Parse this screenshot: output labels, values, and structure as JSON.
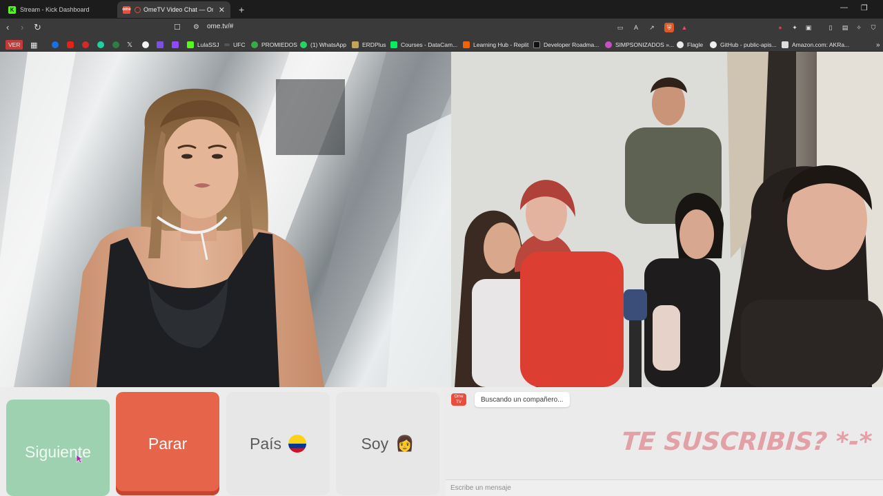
{
  "browser": {
    "tabs": [
      {
        "title": "Stream - Kick Dashboard",
        "active": false,
        "favicon": "kick-icon"
      },
      {
        "title": "OmeTV Video Chat — Omeg",
        "active": true,
        "favicon": "ometv-icon"
      }
    ],
    "new_tab": "+",
    "url": "ome.tv/#",
    "bookmarks": [
      {
        "label": "VER"
      },
      {
        "label": "LulaSSJ"
      },
      {
        "label": "UFC"
      },
      {
        "label": "PROMIEDOS"
      },
      {
        "label": "(1) WhatsApp"
      },
      {
        "label": "ERDPlus"
      },
      {
        "label": "Courses - DataCam..."
      },
      {
        "label": "Learning Hub - Replit"
      },
      {
        "label": "Developer Roadma..."
      },
      {
        "label": "SIMPSONIZADOS »..."
      },
      {
        "label": "Flagle"
      },
      {
        "label": "GitHub - public-apis..."
      },
      {
        "label": "Amazon.com: AKRa..."
      }
    ]
  },
  "controls": {
    "next": "Siguiente",
    "stop": "Parar",
    "country": "País",
    "gender": "Soy"
  },
  "chat": {
    "status_message": "Buscando un compañero...",
    "overlay_text": "TE SUSCRIBIS? *-*",
    "input_placeholder": "Escribe un mensaje",
    "logo_text": "Ome TV"
  },
  "colors": {
    "next_button": "#9dd1b0",
    "stop_button": "#e5644a",
    "overlay_text": "#e2a1a7"
  }
}
